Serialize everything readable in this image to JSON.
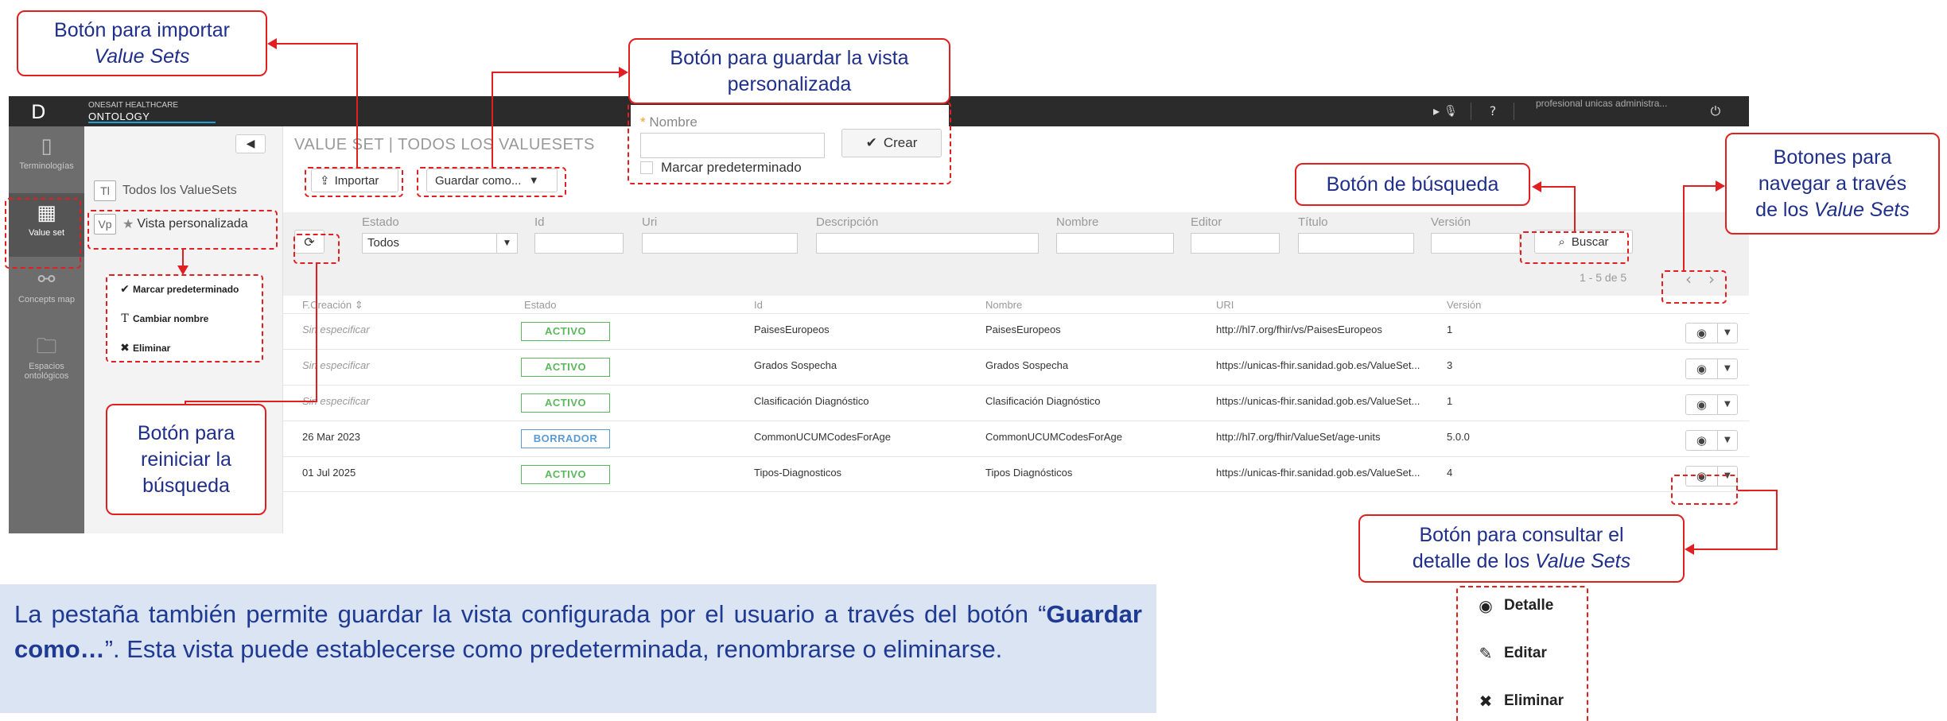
{
  "app": {
    "logo": "D",
    "brand_line1": "ONESAIT HEALTHCARE",
    "brand_line2": "ONTOLOGY",
    "user": "profesional unicas administra...",
    "icons": {
      "mic": "mic-mute-icon",
      "help": "help-icon",
      "power": "power-icon"
    }
  },
  "sidebar": {
    "items": [
      {
        "label": "Terminologías",
        "icon": "book-icon"
      },
      {
        "label": "Value set",
        "icon": "grid-icon",
        "active": true
      },
      {
        "label": "Concepts map",
        "icon": "graph-icon"
      },
      {
        "label": "Espacios ontológicos",
        "icon": "folder-icon"
      }
    ]
  },
  "leftpanel": {
    "items": [
      {
        "badge": "Tl",
        "label": "Todos los ValueSets"
      },
      {
        "badge": "Vp",
        "label": "Vista personalizada",
        "star": "★"
      }
    ]
  },
  "main": {
    "title": "VALUE SET | TODOS LOS VALUESETS",
    "import_label": "Importar",
    "save_as_label": "Guardar como...",
    "filters": {
      "estado_label": "Estado",
      "estado_value": "Todos",
      "id_label": "Id",
      "uri_label": "Uri",
      "descripcion_label": "Descripción",
      "nombre_label": "Nombre",
      "editor_label": "Editor",
      "titulo_label": "Título",
      "version_label": "Versión",
      "buscar_label": "Buscar"
    },
    "results_count": "1 - 5 de 5",
    "columns": [
      "F.Creación ⇕",
      "Estado",
      "Id",
      "Nombre",
      "URI",
      "Versión"
    ],
    "rows": [
      {
        "fecha": "Sin especificar",
        "estado": "ACTIVO",
        "estado_type": "activo",
        "id": "PaisesEuropeos",
        "nombre": "PaisesEuropeos",
        "uri": "http://hl7.org/fhir/vs/PaisesEuropeos",
        "version": "1"
      },
      {
        "fecha": "Sin especificar",
        "estado": "ACTIVO",
        "estado_type": "activo",
        "id": "Grados Sospecha",
        "nombre": "Grados Sospecha",
        "uri": "https://unicas-fhir.sanidad.gob.es/ValueSet...",
        "version": "3"
      },
      {
        "fecha": "Sin especificar",
        "estado": "ACTIVO",
        "estado_type": "activo",
        "id": "Clasificación Diagnóstico",
        "nombre": "Clasificación Diagnóstico",
        "uri": "https://unicas-fhir.sanidad.gob.es/ValueSet...",
        "version": "1"
      },
      {
        "fecha": "26 Mar 2023",
        "estado": "BORRADOR",
        "estado_type": "borrador",
        "id": "CommonUCUMCodesForAge",
        "nombre": "CommonUCUMCodesForAge",
        "uri": "http://hl7.org/fhir/ValueSet/age-units",
        "version": "5.0.0"
      },
      {
        "fecha": "01 Jul 2025",
        "estado": "ACTIVO",
        "estado_type": "activo",
        "id": "Tipos-Diagnosticos",
        "nombre": "Tipos Diagnósticos",
        "uri": "https://unicas-fhir.sanidad.gob.es/ValueSet...",
        "version": "4"
      }
    ]
  },
  "save_popover": {
    "star": "*",
    "nombre_label": "Nombre",
    "crear_label": "Crear",
    "default_label": "Marcar predeterminado"
  },
  "view_menu": {
    "items": [
      {
        "label": "Marcar predeterminado",
        "icon": "check-icon"
      },
      {
        "label": "Cambiar nombre",
        "icon": "text-icon"
      },
      {
        "label": "Eliminar",
        "icon": "x-icon"
      }
    ]
  },
  "row_menu": {
    "items": [
      {
        "label": "Detalle",
        "icon": "eye-icon"
      },
      {
        "label": "Editar",
        "icon": "pencil-icon"
      },
      {
        "label": "Eliminar",
        "icon": "x-icon"
      }
    ]
  },
  "callouts": {
    "importar_l1": "Botón para importar",
    "importar_l2": "Value Sets",
    "guardar_l1": "Botón para guardar la vista",
    "guardar_l2": "personalizada",
    "busqueda": "Botón de búsqueda",
    "navegar_l1": "Botones para",
    "navegar_l2": "navegar a través",
    "navegar_l3a": "de los ",
    "navegar_l3b": "Value Sets",
    "reiniciar_l1": "Botón para",
    "reiniciar_l2": "reiniciar la",
    "reiniciar_l3": "búsqueda",
    "detalle_l1": "Botón para consultar el",
    "detalle_l2a": "detalle de los ",
    "detalle_l2b": "Value Sets"
  },
  "note": {
    "p1": "La pestaña también permite guardar la vista configurada por el usuario a través del botón “",
    "bold": "Guardar como…",
    "p2": "”. Esta vista puede establecerse como predeterminada, renombrarse o eliminarse."
  }
}
